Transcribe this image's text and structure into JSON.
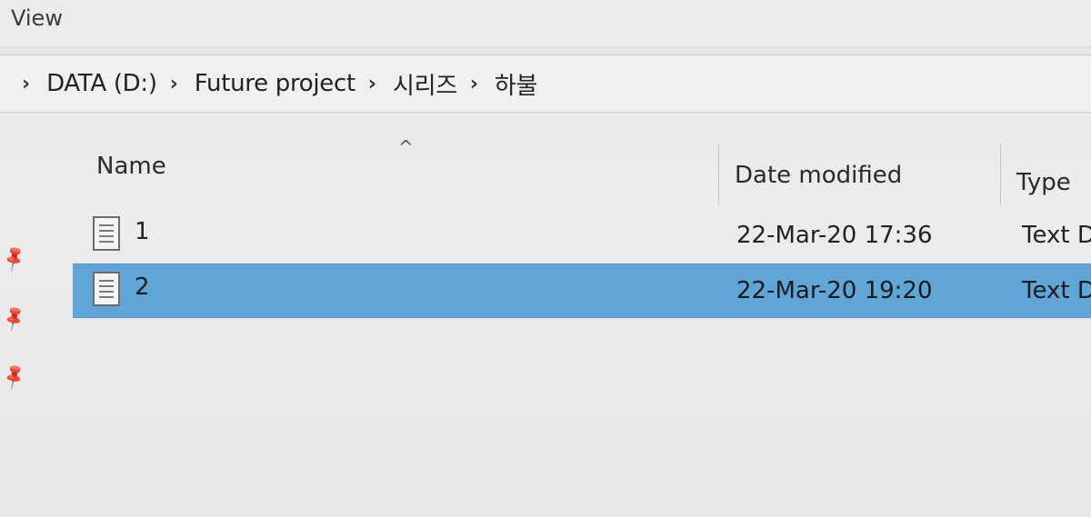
{
  "ribbon": {
    "tab_view": "View"
  },
  "address": {
    "crumbs": [
      "DATA (D:)",
      "Future project",
      "시리즈",
      "하불"
    ]
  },
  "columns": {
    "name": "Name",
    "date_modified": "Date modified",
    "type": "Type"
  },
  "files": [
    {
      "name": "1",
      "date_modified": "22-Mar-20 17:36",
      "type": "Text D",
      "selected": false
    },
    {
      "name": "2",
      "date_modified": "22-Mar-20 19:20",
      "type": "Text D",
      "selected": true
    }
  ],
  "icons": {
    "file": "text-document-icon",
    "pin": "pin-icon",
    "separator": "chevron-right-icon",
    "sort": "sort-ascending-icon"
  },
  "colors": {
    "selection": "#5fa6d6",
    "background": "#e9e9e9"
  }
}
